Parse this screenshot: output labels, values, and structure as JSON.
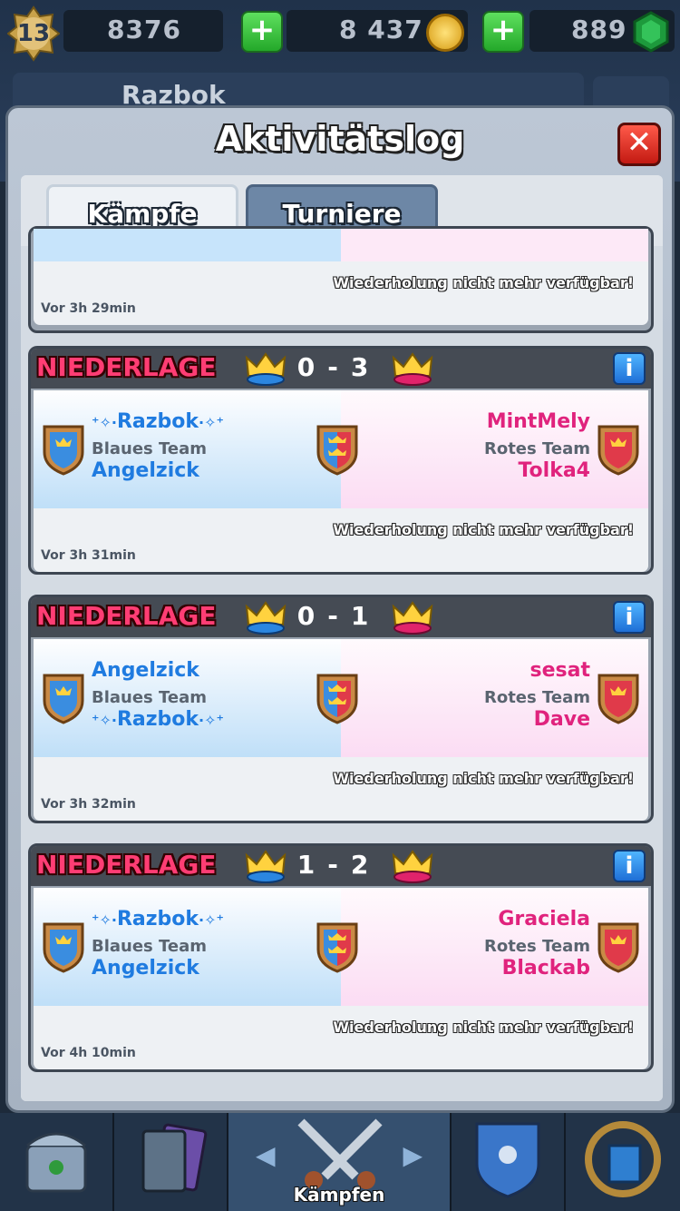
{
  "hud": {
    "level": "13",
    "trophies": "8376",
    "gold": "8 437",
    "gems": "889",
    "profile_name": "Razbok"
  },
  "modal": {
    "title": "Aktivitätslog",
    "close_icon": "close-icon",
    "tabs": [
      {
        "label": "Kämpfe",
        "active": true
      },
      {
        "label": "Turniere",
        "active": false
      }
    ]
  },
  "previous_entry": {
    "replay_text": "Wiederholung nicht mehr verfügbar!",
    "time": "Vor 3h 29min"
  },
  "battles": [
    {
      "result": "NIEDERLAGE",
      "score_left": "0",
      "score_right": "3",
      "score_sep": "-",
      "blue_top": "Razbok",
      "blue_top_is_clan_style": true,
      "blue_label": "Blaues Team",
      "blue_bottom": "Angelzick",
      "red_top": "MintMely",
      "red_label": "Rotes Team",
      "red_bottom": "Tolka4",
      "replay_text": "Wiederholung nicht mehr verfügbar!",
      "time": "Vor 3h 31min"
    },
    {
      "result": "NIEDERLAGE",
      "score_left": "0",
      "score_right": "1",
      "score_sep": "-",
      "blue_top": "Angelzick",
      "blue_label": "Blaues Team",
      "blue_bottom": "Razbok",
      "red_top": "sesat",
      "red_label": "Rotes Team",
      "red_bottom": "Dave",
      "replay_text": "Wiederholung nicht mehr verfügbar!",
      "time": "Vor 3h 32min"
    },
    {
      "result": "NIEDERLAGE",
      "score_left": "1",
      "score_right": "2",
      "score_sep": "-",
      "blue_top": "Razbok",
      "blue_label": "Blaues Team",
      "blue_bottom": "Angelzick",
      "red_top": "Graciela",
      "red_label": "Rotes Team",
      "red_bottom": "Blackab",
      "replay_text": "Wiederholung nicht mehr verfügbar!",
      "time": "Vor 4h 10min"
    }
  ],
  "bottom_nav": {
    "active_label": "Kämpfen"
  },
  "colors": {
    "defeat": "#ff3d74",
    "blue_team": "#1f7be0",
    "red_team": "#e0237d",
    "info_button": "#1f6fd6"
  }
}
